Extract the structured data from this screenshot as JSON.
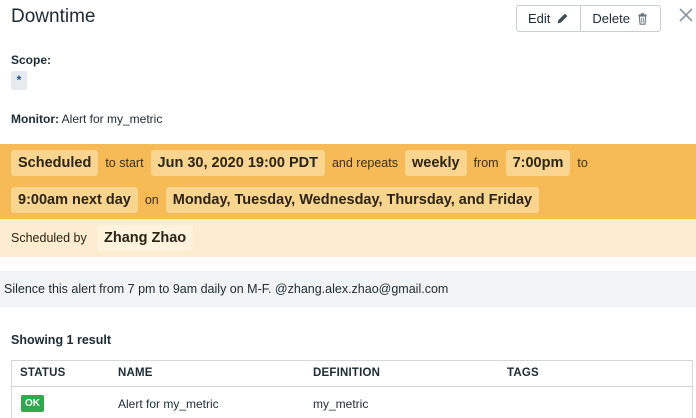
{
  "header": {
    "title": "Downtime",
    "edit_label": "Edit",
    "delete_label": "Delete"
  },
  "scope": {
    "label": "Scope:",
    "value": "*"
  },
  "monitor": {
    "label": "Monitor:",
    "value": "Alert for my_metric"
  },
  "schedule": {
    "status": "Scheduled",
    "to_start_text": "to start",
    "start": "Jun 30, 2020 19:00 PDT",
    "repeats_text": "and repeats",
    "frequency": "weekly",
    "from_text": "from",
    "from_time": "7:00pm",
    "to_text": "to",
    "to_time": "9:00am next day",
    "on_text": "on",
    "days": "Monday, Tuesday, Wednesday, Thursday, and Friday",
    "scheduled_by_label": "Scheduled by",
    "scheduled_by": "Zhang Zhao"
  },
  "message": "Silence this alert from 7 pm to 9am daily on M-F. @zhang.alex.zhao@gmail.com",
  "results": {
    "count_text": "Showing 1 result",
    "columns": [
      "STATUS",
      "NAME",
      "DEFINITION",
      "TAGS"
    ],
    "rows": [
      {
        "status": "OK",
        "name": "Alert for my_metric",
        "definition": "my_metric",
        "tags": ""
      }
    ]
  },
  "colors": {
    "schedule_bg": "#f6bb56",
    "chip_bg": "#f9d58f",
    "scheduled_by_bg": "#fcecd0",
    "ok_badge": "#2eaa4a"
  }
}
